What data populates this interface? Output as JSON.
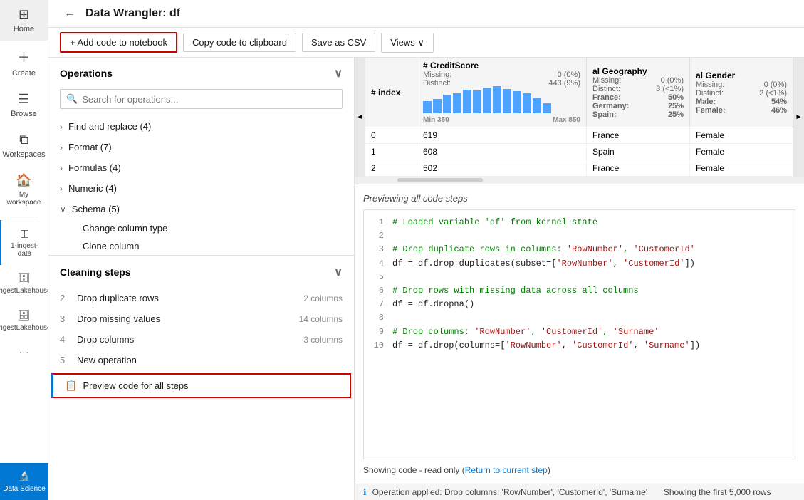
{
  "nav": {
    "items": [
      {
        "id": "home",
        "label": "Home",
        "icon": "⊞"
      },
      {
        "id": "create",
        "label": "Create",
        "icon": "+"
      },
      {
        "id": "browse",
        "label": "Browse",
        "icon": "☰"
      },
      {
        "id": "workspaces",
        "label": "Workspaces",
        "icon": "⧉"
      },
      {
        "id": "my-workspace",
        "label": "My workspace",
        "icon": "🏠"
      },
      {
        "id": "1-ingest-data",
        "label": "1-ingest-data",
        "icon": "◫",
        "active": true
      },
      {
        "id": "ingest-lakehouse-1",
        "label": "IngestLakehouse",
        "icon": "🗄"
      },
      {
        "id": "ingest-lakehouse-2",
        "label": "IngestLakehouse",
        "icon": "🗄"
      },
      {
        "id": "more",
        "label": "...",
        "icon": "···"
      },
      {
        "id": "data-science",
        "label": "Data Science",
        "icon": "🔬"
      }
    ]
  },
  "header": {
    "back_label": "←",
    "title": "Data Wrangler: df"
  },
  "toolbar": {
    "add_notebook_label": "+ Add code to notebook",
    "copy_clipboard_label": "Copy code to clipboard",
    "save_csv_label": "Save as CSV",
    "views_label": "Views ∨"
  },
  "operations": {
    "section_label": "Operations",
    "search_placeholder": "Search for operations...",
    "groups": [
      {
        "id": "find-replace",
        "label": "Find and replace (4)",
        "expanded": false
      },
      {
        "id": "format",
        "label": "Format (7)",
        "expanded": false
      },
      {
        "id": "formulas",
        "label": "Formulas (4)",
        "expanded": false
      },
      {
        "id": "numeric",
        "label": "Numeric (4)",
        "expanded": false
      },
      {
        "id": "schema",
        "label": "Schema (5)",
        "expanded": true
      }
    ],
    "schema_sub_items": [
      {
        "label": "Change column type"
      },
      {
        "label": "Clone column"
      }
    ]
  },
  "cleaning_steps": {
    "section_label": "Cleaning steps",
    "items": [
      {
        "num": "2",
        "label": "Drop duplicate rows",
        "detail": "2 columns"
      },
      {
        "num": "3",
        "label": "Drop missing values",
        "detail": "14 columns"
      },
      {
        "num": "4",
        "label": "Drop columns",
        "detail": "3 columns"
      },
      {
        "num": "5",
        "label": "New operation",
        "detail": ""
      }
    ],
    "preview_label": "Preview code for all steps"
  },
  "data_table": {
    "columns": [
      {
        "type": "#",
        "name": "index"
      },
      {
        "type": "#",
        "name": "CreditScore",
        "missing": "0 (0%)",
        "distinct": "443 (9%)",
        "has_histogram": true,
        "hist_bars": [
          35,
          42,
          55,
          60,
          70,
          68,
          75,
          80,
          72,
          65,
          58,
          45,
          30
        ],
        "min": "Min 350",
        "max": "Max 850"
      },
      {
        "type": "al",
        "name": "Geography",
        "missing": "0 (0%)",
        "distinct": "3 (<1%)",
        "geo_values": [
          {
            "label": "France:",
            "pct": "50%"
          },
          {
            "label": "Germany:",
            "pct": "25%"
          },
          {
            "label": "Spain:",
            "pct": "25%"
          }
        ]
      },
      {
        "type": "al",
        "name": "Gender",
        "missing": "0 (0%)",
        "distinct": "2 (<1%)",
        "geo_values": [
          {
            "label": "Male:",
            "pct": "54%"
          },
          {
            "label": "Female:",
            "pct": "46%"
          }
        ]
      }
    ],
    "rows": [
      {
        "index": "0",
        "credit_score": "619",
        "geography": "France",
        "gender": "Female"
      },
      {
        "index": "1",
        "credit_score": "608",
        "geography": "Spain",
        "gender": "Female"
      },
      {
        "index": "2",
        "credit_score": "502",
        "geography": "France",
        "gender": "Female"
      }
    ]
  },
  "code_preview": {
    "title": "Previewing all code steps",
    "lines": [
      {
        "num": "1",
        "content": "# Loaded variable 'df' from kernel state",
        "type": "comment"
      },
      {
        "num": "2",
        "content": "",
        "type": "plain"
      },
      {
        "num": "3",
        "content": "# Drop duplicate rows in columns: 'RowNumber', 'CustomerId'",
        "type": "comment"
      },
      {
        "num": "4",
        "content": "df = df.drop_duplicates(subset=['RowNumber', 'CustomerId'])",
        "type": "code-mixed"
      },
      {
        "num": "5",
        "content": "",
        "type": "plain"
      },
      {
        "num": "6",
        "content": "# Drop rows with missing data across all columns",
        "type": "comment"
      },
      {
        "num": "7",
        "content": "df = df.dropna()",
        "type": "code-mixed"
      },
      {
        "num": "8",
        "content": "",
        "type": "plain"
      },
      {
        "num": "9",
        "content": "# Drop columns: 'RowNumber', 'CustomerId', 'Surname'",
        "type": "comment"
      },
      {
        "num": "10",
        "content": "df = df.drop(columns=['RowNumber', 'CustomerId', 'Surname'])",
        "type": "code-mixed"
      }
    ],
    "showing_text": "Showing code - read only",
    "return_link_text": "Return to current step",
    "return_link_href": "#"
  },
  "status_bar": {
    "message": "Operation applied: Drop columns: 'RowNumber', 'CustomerId', 'Surname'",
    "rows_info": "Showing the first 5,000 rows"
  }
}
